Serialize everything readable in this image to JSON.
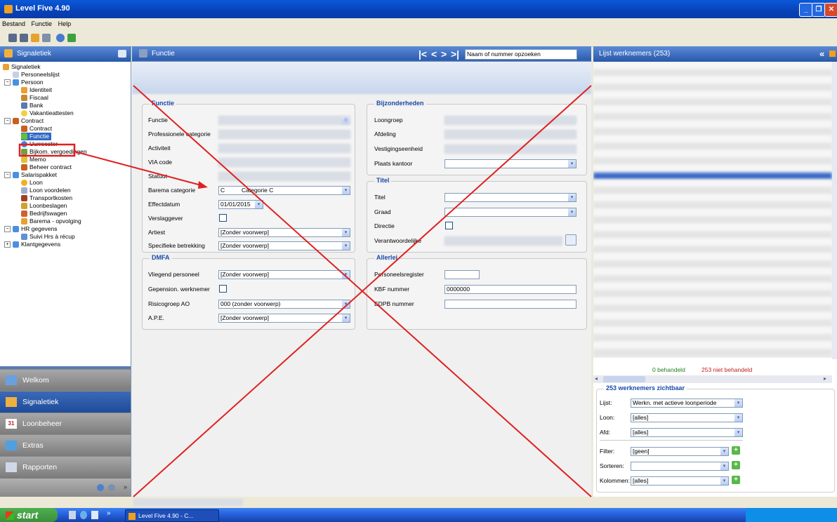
{
  "window": {
    "title": "Level Five 4.90",
    "colors": {
      "titlebar": "#0a58d8",
      "annotation": "#e02020"
    }
  },
  "menu": [
    "Bestand",
    "Functie",
    "Help"
  ],
  "left": {
    "header": "Signaletiek",
    "tree": [
      "Signaletiek",
      "Personeelslijst",
      "Persoon",
      "Identiteit",
      "Fiscaal",
      "Bank",
      "Vakantieattesten",
      "Contract",
      "Contract",
      "Functie",
      "Uurrooster",
      "Bijkom. vergoedingen",
      "Memo",
      "Beheer contract",
      "Salarispakket",
      "Loon",
      "Loon voordelen",
      "Transportkosten",
      "Loonbeslagen",
      "Bedrijfswagen",
      "Barema - opvolging",
      "HR gegevens",
      "Suivi Hrs à récup",
      "Klantgegevens"
    ],
    "nav": [
      "Welkom",
      "Signaletiek",
      "Loonbeheer",
      "Extras",
      "Rapporten"
    ],
    "calendar_day": "31"
  },
  "center": {
    "header": "Functie",
    "search_placeholder": "Naam of nummer opzoeken",
    "functie": {
      "title": "Functie",
      "labels": [
        "Functie",
        "Professionele categorie",
        "Activiteit",
        "VIA code",
        "Statuut",
        "Barema categorie",
        "Effectdatum",
        "Verslaggever",
        "Artiest",
        "Specifieke betrekking"
      ],
      "barema_code": "C",
      "barema_value": "Categorie C",
      "effectdatum": "01/01/2015",
      "artiest": "[Zonder voorwerp]",
      "specifieke": "[Zonder voorwerp]"
    },
    "dmfa": {
      "title": "DMFA",
      "labels": [
        "Vliegend personeel",
        "Gepension. werknemer",
        "Risicogroep AO",
        "A.P.E."
      ],
      "vliegend": "[Zonder voorwerp]",
      "risicogroep": "000 (zonder voorwerp)",
      "ape": "[Zonder voorwerp]"
    },
    "bijzonderheden": {
      "title": "Bijzonderheden",
      "labels": [
        "Loongroep",
        "Afdeling",
        "Vestigingseenheid",
        "Plaats kantoor"
      ]
    },
    "titel": {
      "title": "Titel",
      "labels": [
        "Titel",
        "Graad",
        "Directie",
        "Verantwoordelijke"
      ]
    },
    "allerlei": {
      "title": "Allerlei",
      "labels": [
        "Personeelsregister",
        "KBF nummer",
        "EDPB nummer"
      ],
      "kbf": "0000000"
    }
  },
  "right": {
    "header": "Lijst werknemers (253)",
    "behandeld": "0 behandeld",
    "niet_behandeld": "253 niet behandeld",
    "zichtbaar": "253 werknemers zichtbaar",
    "filters": [
      {
        "label": "Lijst:",
        "value": "Werkn. met actieve loonperiode"
      },
      {
        "label": "Loon:",
        "value": "[alles]"
      },
      {
        "label": "Afd:",
        "value": "[alles]"
      },
      {
        "label": "Filter:",
        "value": "[geen]"
      },
      {
        "label": "Sorteren:",
        "value": ""
      },
      {
        "label": "Kolommen:",
        "value": "[alles]"
      }
    ]
  },
  "taskbar": {
    "start": "start",
    "item": "Level Five 4.90 - C..."
  }
}
